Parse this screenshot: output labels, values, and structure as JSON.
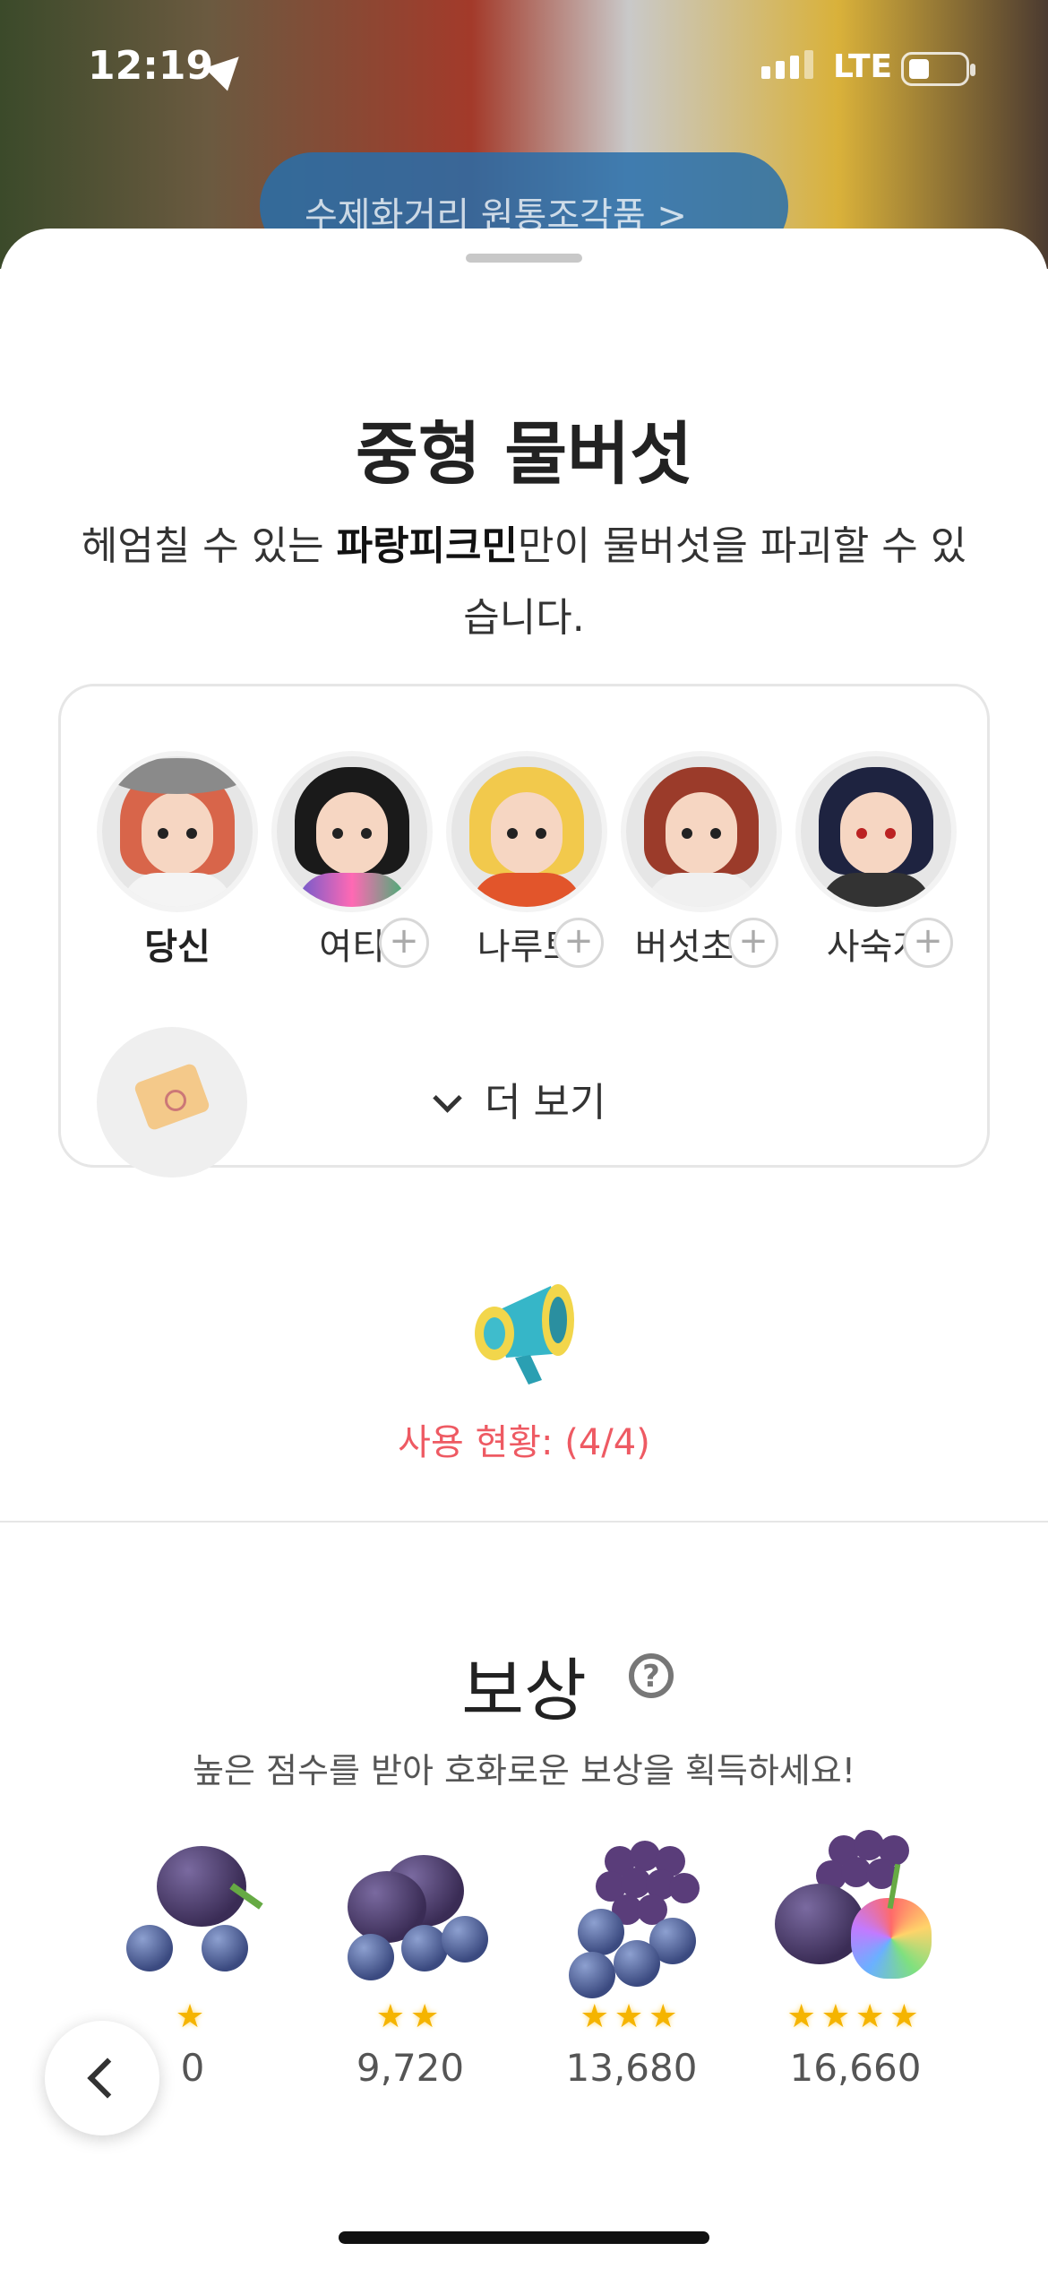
{
  "status_bar": {
    "time": "12:19",
    "network": "LTE",
    "icons": [
      "location-icon",
      "signal-icon",
      "battery-icon"
    ]
  },
  "background": {
    "banner_text": "수제화거리 원통조각품 >"
  },
  "header": {
    "title": "중형 물버섯",
    "desc_before": "헤엄칠 수 있는 ",
    "desc_bold": "파랑피크민",
    "desc_after": "만이 물버섯을 파괴할 수 있습니다."
  },
  "members": [
    {
      "name": "당신",
      "you": true
    },
    {
      "name": "여티"
    },
    {
      "name": "나루토"
    },
    {
      "name": "버섯초..."
    },
    {
      "name": "사숙게"
    }
  ],
  "more_label": "더 보기",
  "usage_text": "사용 현황: (4/4)",
  "rewards": {
    "title": "보상",
    "subtitle": "높은 점수를 받아 호화로운 보상을 획득하세요!",
    "tiers": [
      {
        "stars": "★",
        "score": "0"
      },
      {
        "stars": "★★",
        "score": "9,720"
      },
      {
        "stars": "★★★",
        "score": "13,680"
      },
      {
        "stars": "★★★★",
        "score": "16,660"
      }
    ]
  },
  "colors": {
    "accent_red": "#ee5a63",
    "star": "#f5b400"
  }
}
